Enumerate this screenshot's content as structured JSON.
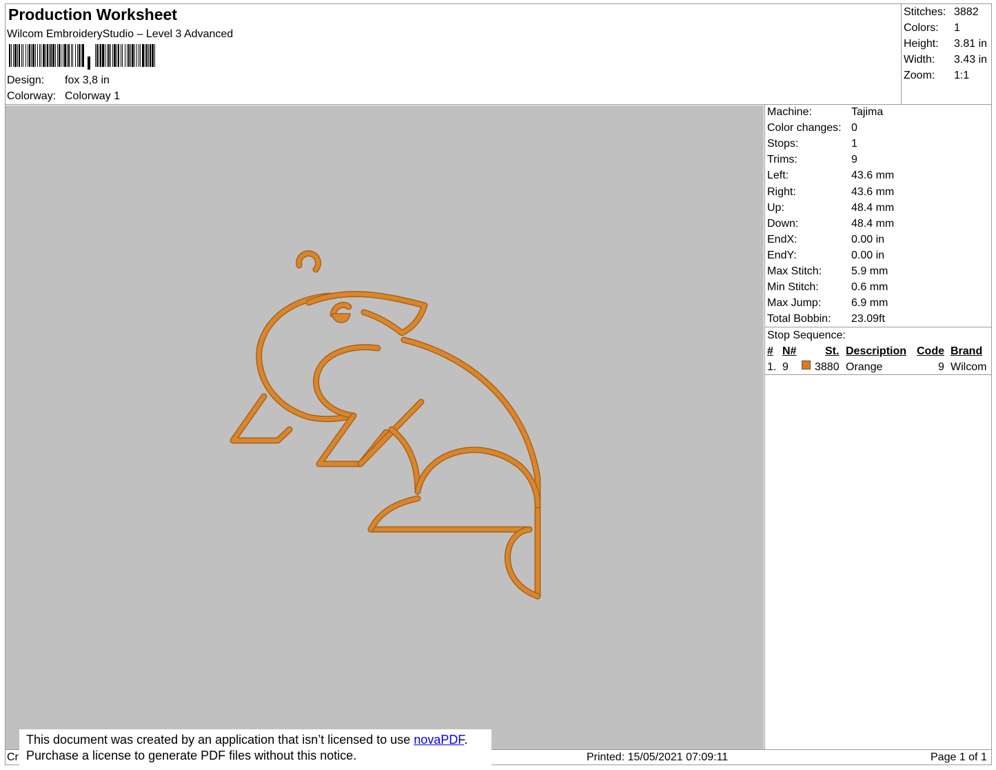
{
  "header": {
    "title": "Production Worksheet",
    "subtitle": "Wilcom EmbroideryStudio – Level 3 Advanced",
    "design_label": "Design:",
    "design_value": "fox 3,8 in",
    "colorway_label": "Colorway:",
    "colorway_value": "Colorway 1"
  },
  "summary": {
    "stitches_label": "Stitches:",
    "stitches_value": "3882",
    "colors_label": "Colors:",
    "colors_value": "1",
    "height_label": "Height:",
    "height_value": "3.81 in",
    "width_label": "Width:",
    "width_value": "3.43 in",
    "zoom_label": "Zoom:",
    "zoom_value": "1:1"
  },
  "details": [
    {
      "label": "Machine:",
      "value": "Tajima"
    },
    {
      "label": "Color changes:",
      "value": "0"
    },
    {
      "label": "Stops:",
      "value": "1"
    },
    {
      "label": "Trims:",
      "value": "9"
    },
    {
      "label": "Left:",
      "value": "43.6 mm"
    },
    {
      "label": "Right:",
      "value": "43.6 mm"
    },
    {
      "label": "Up:",
      "value": "48.4 mm"
    },
    {
      "label": "Down:",
      "value": "48.4 mm"
    },
    {
      "label": "EndX:",
      "value": "0.00 in"
    },
    {
      "label": "EndY:",
      "value": "0.00 in"
    },
    {
      "label": "Max Stitch:",
      "value": "5.9 mm"
    },
    {
      "label": "Min Stitch:",
      "value": "0.6 mm"
    },
    {
      "label": "Max Jump:",
      "value": "6.9 mm"
    },
    {
      "label": "Total Bobbin:",
      "value": "23.09ft"
    }
  ],
  "stop_sequence": {
    "title": "Stop Sequence:",
    "headers": {
      "num": "#",
      "needle": "N#",
      "stitches": "St.",
      "description": "Description",
      "code": "Code",
      "brand": "Brand"
    },
    "rows": [
      {
        "num": "1.",
        "needle": "9",
        "color": "#e07a1f",
        "stitches": "3880",
        "description": "Orange",
        "code": "9",
        "brand": "Wilcom"
      }
    ]
  },
  "design": {
    "thread_color": "#d9862c",
    "thread_shadow": "#a9621a",
    "background_color": "#c0c0c0",
    "icon": "fox-embroidery-outline"
  },
  "footer": {
    "left_fragment": "Cr",
    "notice_line1_prefix": "This document was created by an application that isn’t licensed to use ",
    "notice_link": "novaPDF",
    "notice_line1_suffix": ".",
    "notice_line2": "Purchase a license to generate PDF files without this notice.",
    "printed": "Printed: 15/05/2021 07:09:11",
    "page": "Page 1 of 1"
  }
}
